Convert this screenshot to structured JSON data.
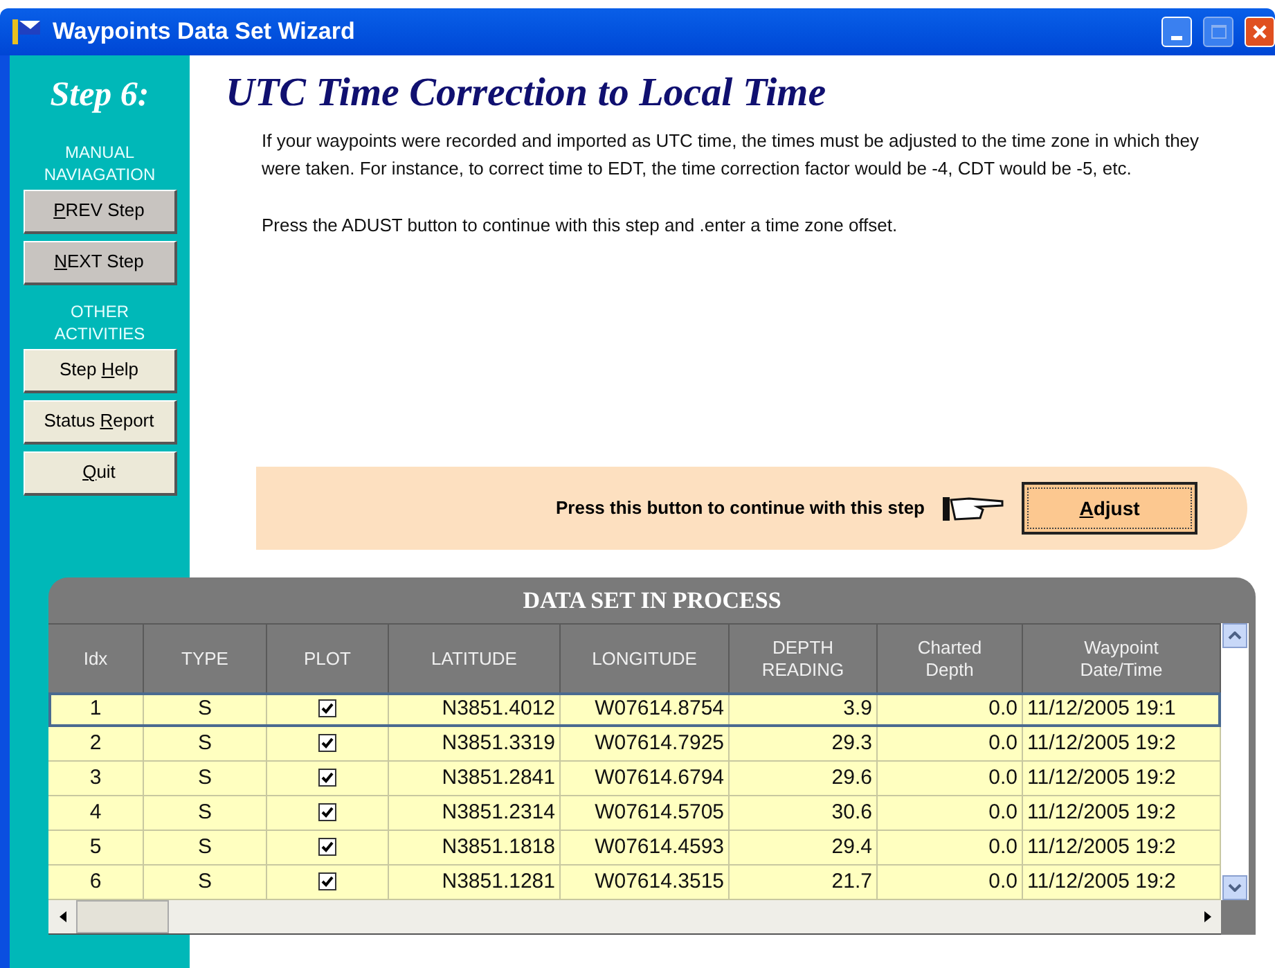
{
  "window": {
    "title": "Waypoints Data Set Wizard"
  },
  "sidebar": {
    "step": "Step 6:",
    "sections": [
      {
        "heading": "MANUAL NAVIAGATION",
        "buttons": [
          {
            "label": {
              "key": "P",
              "post": "REV Step"
            },
            "kind": "nav"
          },
          {
            "label": {
              "key": "N",
              "post": "EXT Step"
            },
            "kind": "nav"
          }
        ]
      },
      {
        "heading": "OTHER ACTIVITIES",
        "buttons": [
          {
            "label": {
              "pre": "Step ",
              "key": "H",
              "post": "elp"
            },
            "kind": "action"
          },
          {
            "label": {
              "pre": "Status ",
              "key": "R",
              "post": "eport"
            },
            "kind": "action"
          },
          {
            "label": {
              "key": "Q",
              "post": "uit"
            },
            "kind": "action"
          }
        ]
      }
    ]
  },
  "heading": "UTC Time Correction to Local Time",
  "paragraphs": [
    "If your waypoints were recorded and imported as UTC time, the times must be adjusted to the time zone in which they were taken.  For instance, to correct time to EDT, the  time correction factor would be -4, CDT would be -5, etc.",
    "Press the ADUST button to continue with this step and .enter a time zone offset."
  ],
  "action_bar": {
    "prompt": "Press this button to continue with this step",
    "button": {
      "label": {
        "key": "A",
        "post": "djust"
      }
    }
  },
  "table": {
    "title": "DATA SET IN PROCESS",
    "columns": [
      "Idx",
      "TYPE",
      "PLOT",
      "LATITUDE",
      "LONGITUDE",
      "DEPTH READING",
      "Charted Depth",
      "Waypoint Date/Time"
    ],
    "rows": [
      {
        "idx": "1",
        "type": "S",
        "plot": true,
        "latitude": "N3851.4012",
        "longitude": "W07614.8754",
        "depth": "3.9",
        "charted": "0.0",
        "datetime": "11/12/2005 19:1",
        "selected": true
      },
      {
        "idx": "2",
        "type": "S",
        "plot": true,
        "latitude": "N3851.3319",
        "longitude": "W07614.7925",
        "depth": "29.3",
        "charted": "0.0",
        "datetime": "11/12/2005 19:2",
        "selected": false
      },
      {
        "idx": "3",
        "type": "S",
        "plot": true,
        "latitude": "N3851.2841",
        "longitude": "W07614.6794",
        "depth": "29.6",
        "charted": "0.0",
        "datetime": "11/12/2005 19:2",
        "selected": false
      },
      {
        "idx": "4",
        "type": "S",
        "plot": true,
        "latitude": "N3851.2314",
        "longitude": "W07614.5705",
        "depth": "30.6",
        "charted": "0.0",
        "datetime": "11/12/2005 19:2",
        "selected": false
      },
      {
        "idx": "5",
        "type": "S",
        "plot": true,
        "latitude": "N3851.1818",
        "longitude": "W07614.4593",
        "depth": "29.4",
        "charted": "0.0",
        "datetime": "11/12/2005 19:2",
        "selected": false
      },
      {
        "idx": "6",
        "type": "S",
        "plot": true,
        "latitude": "N3851.1281",
        "longitude": "W07614.3515",
        "depth": "21.7",
        "charted": "0.0",
        "datetime": "11/12/2005 19:2",
        "selected": false
      }
    ]
  }
}
